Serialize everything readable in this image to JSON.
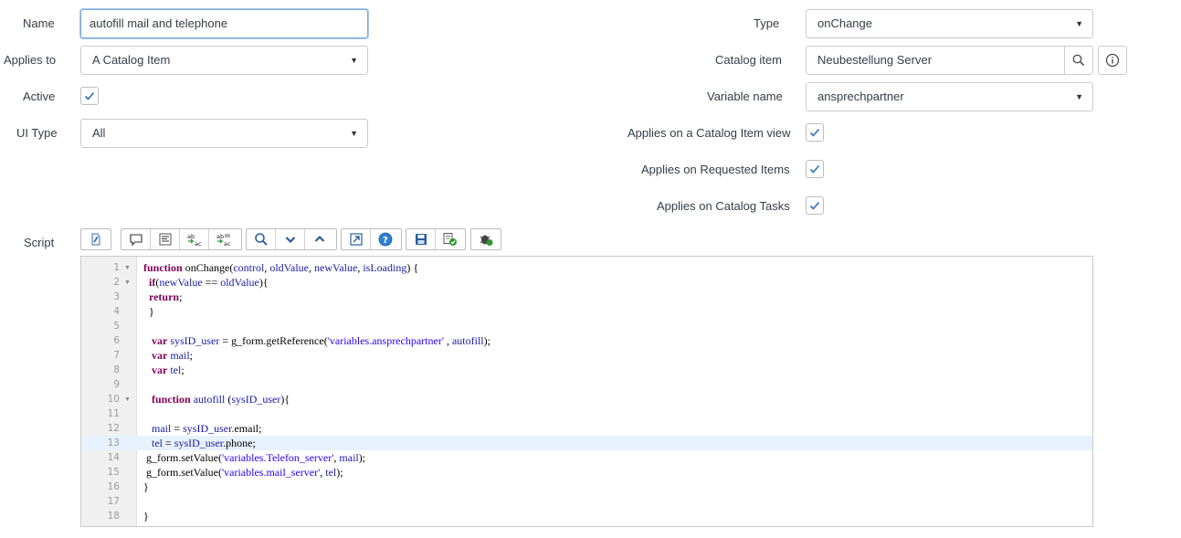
{
  "left": {
    "name_label": "Name",
    "name_value": "autofill mail and telephone",
    "applies_to_label": "Applies to",
    "applies_to_value": "A Catalog Item",
    "active_label": "Active",
    "ui_type_label": "UI Type",
    "ui_type_value": "All",
    "script_label": "Script"
  },
  "right": {
    "type_label": "Type",
    "type_value": "onChange",
    "catalog_item_label": "Catalog item",
    "catalog_item_value": "Neubestellung Server",
    "variable_name_label": "Variable name",
    "variable_name_value": "ansprechpartner",
    "applies_catalog_view_label": "Applies on a Catalog Item view",
    "applies_requested_items_label": "Applies on Requested Items",
    "applies_catalog_tasks_label": "Applies on Catalog Tasks"
  },
  "checkboxes": {
    "active": true,
    "applies_catalog_view": true,
    "applies_requested_items": true,
    "applies_catalog_tasks": true
  },
  "colors": {
    "accent": "#2f6fb3",
    "keyword": "#7f0055",
    "variable": "#1a1aa6",
    "string": "#2a00ff",
    "active_line": "#e8f2fe"
  },
  "toolbar": [
    [
      "toggle-syntax-icon"
    ],
    [
      "comment-icon",
      "format-code-icon",
      "replace-icon",
      "replace-all-icon"
    ],
    [
      "search-icon",
      "find-next-icon",
      "find-previous-icon"
    ],
    [
      "fullscreen-icon",
      "help-icon"
    ],
    [
      "save-icon",
      "script-debug-icon"
    ],
    [
      "debugger-icon"
    ]
  ],
  "script": {
    "active_line": 13,
    "lines": [
      {
        "n": "1",
        "fold": true,
        "code": "function onChange(control, oldValue, newValue, isLoading) {"
      },
      {
        "n": "2",
        "fold": true,
        "code": "  if(newValue == oldValue){"
      },
      {
        "n": "3",
        "fold": false,
        "code": "  return;"
      },
      {
        "n": "4",
        "fold": false,
        "code": "  }"
      },
      {
        "n": "5",
        "fold": false,
        "code": ""
      },
      {
        "n": "6",
        "fold": false,
        "code": "   var sysID_user = g_form.getReference('variables.ansprechpartner' , autofill);"
      },
      {
        "n": "7",
        "fold": false,
        "code": "   var mail;"
      },
      {
        "n": "8",
        "fold": false,
        "code": "   var tel;"
      },
      {
        "n": "9",
        "fold": false,
        "code": ""
      },
      {
        "n": "10",
        "fold": true,
        "code": "   function autofill (sysID_user){"
      },
      {
        "n": "11",
        "fold": false,
        "code": ""
      },
      {
        "n": "12",
        "fold": false,
        "code": "   mail = sysID_user.email;"
      },
      {
        "n": "13",
        "fold": false,
        "code": "   tel = sysID_user.phone;"
      },
      {
        "n": "14",
        "fold": false,
        "code": " g_form.setValue('variables.Telefon_server', mail);"
      },
      {
        "n": "15",
        "fold": false,
        "code": " g_form.setValue('variables.mail_server', tel);"
      },
      {
        "n": "16",
        "fold": false,
        "code": "}"
      },
      {
        "n": "17",
        "fold": false,
        "code": ""
      },
      {
        "n": "18",
        "fold": false,
        "code": "}"
      }
    ]
  }
}
